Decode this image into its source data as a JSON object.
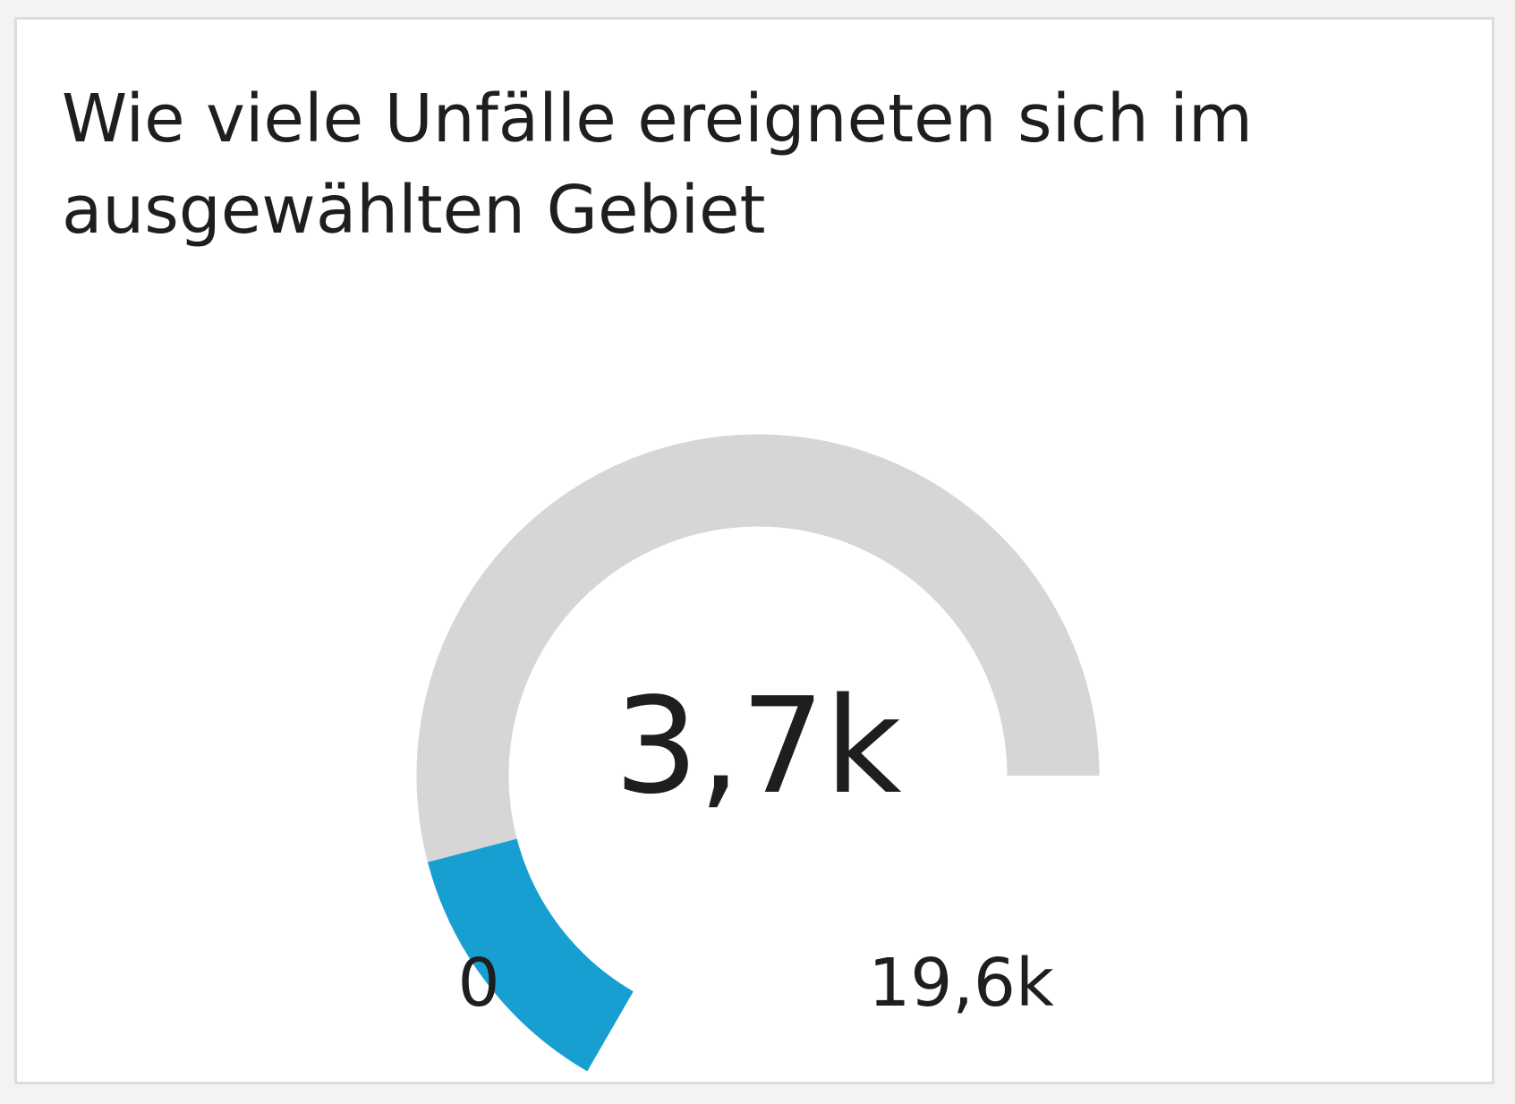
{
  "chart_data": {
    "type": "gauge",
    "title": "Wie viele Unfälle ereigneten sich im ausgewählten Gebiet",
    "value": 3700,
    "value_label": "3,7k",
    "min": 0,
    "max": 19600,
    "min_label": "0",
    "max_label": "19,6k",
    "colors": {
      "fill": "#169fd0",
      "track": "#d6d6d6",
      "text": "#1e1e1e"
    }
  }
}
